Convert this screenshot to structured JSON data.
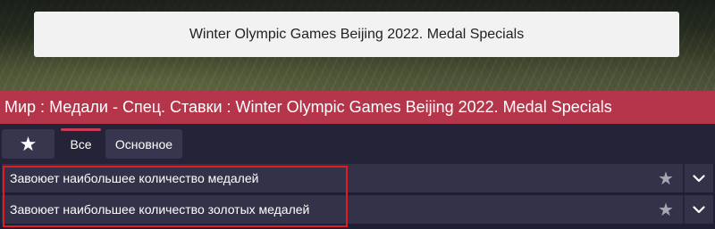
{
  "hero": {
    "title": "Winter Olympic Games Beijing 2022. Medal Specials"
  },
  "breadcrumb": {
    "text": "Мир : Медали - Спец. Ставки : Winter Olympic Games Beijing 2022. Medal Specials"
  },
  "tabs": {
    "favorite_icon": "star-icon",
    "all_label": "Все",
    "main_label": "Основное",
    "active": "Все"
  },
  "markets": [
    {
      "label": "Завоюет наибольшее количество медалей",
      "star_icon": "star-icon",
      "expand_icon": "chevron-down-icon"
    },
    {
      "label": "Завоюет наибольшее количество золотых медалей",
      "star_icon": "star-icon",
      "expand_icon": "chevron-down-icon"
    }
  ],
  "colors": {
    "breadcrumb_bg": "#b5364a",
    "active_tab_indicator": "#c93a54",
    "highlight_border": "#e01b24",
    "row_bg": "#343248",
    "page_bg": "#252338"
  }
}
